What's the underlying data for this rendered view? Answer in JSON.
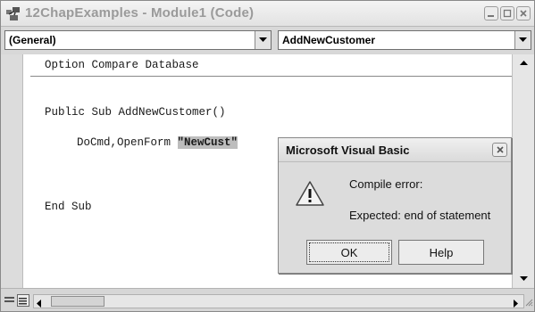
{
  "window": {
    "title": "12ChapExamples - Module1 (Code)",
    "icon": "vba-project-icon"
  },
  "toolbar": {
    "object_combo": "(General)",
    "procedure_combo": "AddNewCustomer"
  },
  "code": {
    "lines": [
      "Option Compare Database",
      "Public Sub AddNewCustomer()",
      "DoCmd,OpenForm ",
      "\"NewCust\"",
      "End Sub"
    ]
  },
  "dialog": {
    "title": "Microsoft Visual Basic",
    "icon": "warning-icon",
    "message_1": "Compile error:",
    "message_2": "Expected: end of statement",
    "ok_label": "OK",
    "help_label": "Help"
  },
  "colors": {
    "selection": "#bdbdbd",
    "dialog_bg": "#dcdcdc",
    "title_text": "#9a9a9a"
  }
}
